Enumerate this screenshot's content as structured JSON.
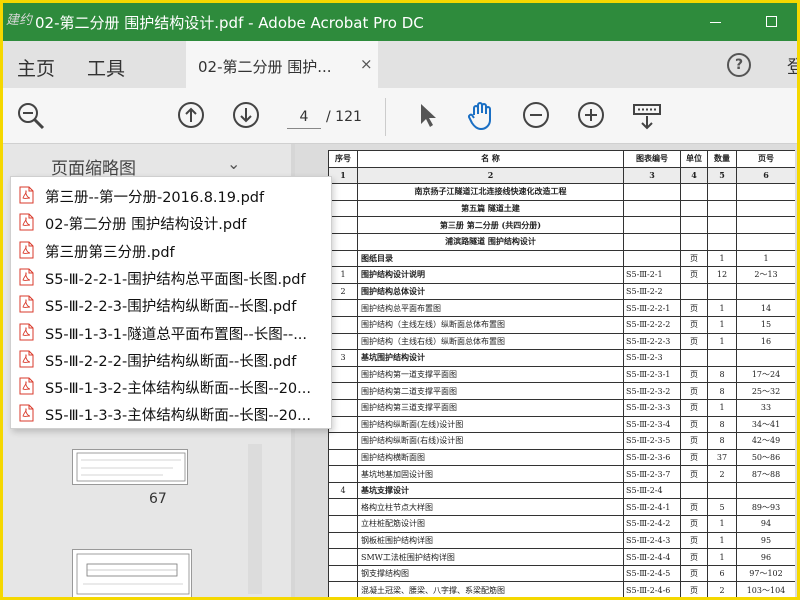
{
  "window": {
    "title": "02-第二分册  围护结构设计.pdf - Adobe Acrobat Pro DC",
    "logo_text": "建约言"
  },
  "tabs": {
    "home": "主页",
    "tools": "工具",
    "doc": "02-第二分册  围护...",
    "close": "×",
    "signin_partial": "登"
  },
  "toolbar": {
    "page_current": "4",
    "page_total": "/ 121"
  },
  "sidepanel": {
    "header": "页面缩略图",
    "thumb_label": "67"
  },
  "jump_list": [
    "第三册--第一分册-2016.8.19.pdf",
    "02-第二分册  围护结构设计.pdf",
    "第三册第三分册.pdf",
    "S5-Ⅲ-2-2-1-围护结构总平面图-长图.pdf",
    "S5-Ⅲ-2-2-3-围护结构纵断面--长图.pdf",
    "S5-Ⅲ-1-3-1-隧道总平面布置图--长图--...",
    "S5-Ⅲ-2-2-2-围护结构纵断面--长图.pdf",
    "S5-Ⅲ-1-3-2-主体结构纵断面--长图--20...",
    "S5-Ⅲ-1-3-3-主体结构纵断面--长图--20..."
  ],
  "toc": {
    "headers": [
      "序号",
      "名      称",
      "图表编号",
      "单位",
      "数量",
      "页号"
    ],
    "col_numbers": [
      "1",
      "2",
      "3",
      "4",
      "5",
      "6"
    ],
    "rows": [
      {
        "no": "",
        "name": "南京扬子江隧道江北连接线快速化改造工程",
        "code": "",
        "unit": "",
        "qty": "",
        "page": "",
        "style": "head"
      },
      {
        "no": "",
        "name": "第五篇   隧道土建",
        "code": "",
        "unit": "",
        "qty": "",
        "page": "",
        "style": "head"
      },
      {
        "no": "",
        "name": "第三册  第二分册 (共四分册)",
        "code": "",
        "unit": "",
        "qty": "",
        "page": "",
        "style": "head"
      },
      {
        "no": "",
        "name": "浦滨路隧道   围护结构设计",
        "code": "",
        "unit": "",
        "qty": "",
        "page": "",
        "style": "head"
      },
      {
        "no": "",
        "name": "图纸目录",
        "code": "",
        "unit": "页",
        "qty": "1",
        "page": "1",
        "style": "bold"
      },
      {
        "no": "1",
        "name": "围护结构设计说明",
        "code": "S5-Ⅲ-2-1",
        "unit": "页",
        "qty": "12",
        "page": "2～13",
        "style": "bold"
      },
      {
        "no": "2",
        "name": "围护结构总体设计",
        "code": "S5-Ⅲ-2-2",
        "unit": "",
        "qty": "",
        "page": "",
        "style": "bold"
      },
      {
        "no": "",
        "name": "围护结构总平面布置图",
        "code": "S5-Ⅲ-2-2-1",
        "unit": "页",
        "qty": "1",
        "page": "14",
        "style": ""
      },
      {
        "no": "",
        "name": "围护结构（主线左线）纵断面总体布置图",
        "code": "S5-Ⅲ-2-2-2",
        "unit": "页",
        "qty": "1",
        "page": "15",
        "style": ""
      },
      {
        "no": "",
        "name": "围护结构（主线右线）纵断面总体布置图",
        "code": "S5-Ⅲ-2-2-3",
        "unit": "页",
        "qty": "1",
        "page": "16",
        "style": ""
      },
      {
        "no": "3",
        "name": "基坑围护结构设计",
        "code": "S5-Ⅲ-2-3",
        "unit": "",
        "qty": "",
        "page": "",
        "style": "bold"
      },
      {
        "no": "",
        "name": "围护结构第一道支撑平面图",
        "code": "S5-Ⅲ-2-3-1",
        "unit": "页",
        "qty": "8",
        "page": "17～24",
        "style": ""
      },
      {
        "no": "",
        "name": "围护结构第二道支撑平面图",
        "code": "S5-Ⅲ-2-3-2",
        "unit": "页",
        "qty": "8",
        "page": "25～32",
        "style": ""
      },
      {
        "no": "",
        "name": "围护结构第三道支撑平面图",
        "code": "S5-Ⅲ-2-3-3",
        "unit": "页",
        "qty": "1",
        "page": "33",
        "style": ""
      },
      {
        "no": "",
        "name": "围护结构纵断面(左线)设计图",
        "code": "S5-Ⅲ-2-3-4",
        "unit": "页",
        "qty": "8",
        "page": "34～41",
        "style": ""
      },
      {
        "no": "",
        "name": "围护结构纵断面(右线)设计图",
        "code": "S5-Ⅲ-2-3-5",
        "unit": "页",
        "qty": "8",
        "page": "42～49",
        "style": ""
      },
      {
        "no": "",
        "name": "围护结构横断面图",
        "code": "S5-Ⅲ-2-3-6",
        "unit": "页",
        "qty": "37",
        "page": "50～86",
        "style": ""
      },
      {
        "no": "",
        "name": "基坑地基加固设计图",
        "code": "S5-Ⅲ-2-3-7",
        "unit": "页",
        "qty": "2",
        "page": "87～88",
        "style": ""
      },
      {
        "no": "4",
        "name": "基坑支撑设计",
        "code": "S5-Ⅲ-2-4",
        "unit": "",
        "qty": "",
        "page": "",
        "style": "bold"
      },
      {
        "no": "",
        "name": "格构立柱节点大样图",
        "code": "S5-Ⅲ-2-4-1",
        "unit": "页",
        "qty": "5",
        "page": "89～93",
        "style": ""
      },
      {
        "no": "",
        "name": "立柱桩配筋设计图",
        "code": "S5-Ⅲ-2-4-2",
        "unit": "页",
        "qty": "1",
        "page": "94",
        "style": ""
      },
      {
        "no": "",
        "name": "钢板桩围护结构详图",
        "code": "S5-Ⅲ-2-4-3",
        "unit": "页",
        "qty": "1",
        "page": "95",
        "style": ""
      },
      {
        "no": "",
        "name": "SMW工法桩围护结构详图",
        "code": "S5-Ⅲ-2-4-4",
        "unit": "页",
        "qty": "1",
        "page": "96",
        "style": ""
      },
      {
        "no": "",
        "name": "钢支撑结构图",
        "code": "S5-Ⅲ-2-4-5",
        "unit": "页",
        "qty": "6",
        "page": "97～102",
        "style": ""
      },
      {
        "no": "",
        "name": "混凝土冠梁、腰梁、八字撑、系梁配筋图",
        "code": "S5-Ⅲ-2-4-6",
        "unit": "页",
        "qty": "2",
        "page": "103～104",
        "style": ""
      }
    ]
  },
  "colors": {
    "titlebar": "#2e8b3c",
    "outer_border": "#f5d800",
    "hand_tool": "#1a6fc4",
    "pdf_icon": "#d93a2b"
  }
}
